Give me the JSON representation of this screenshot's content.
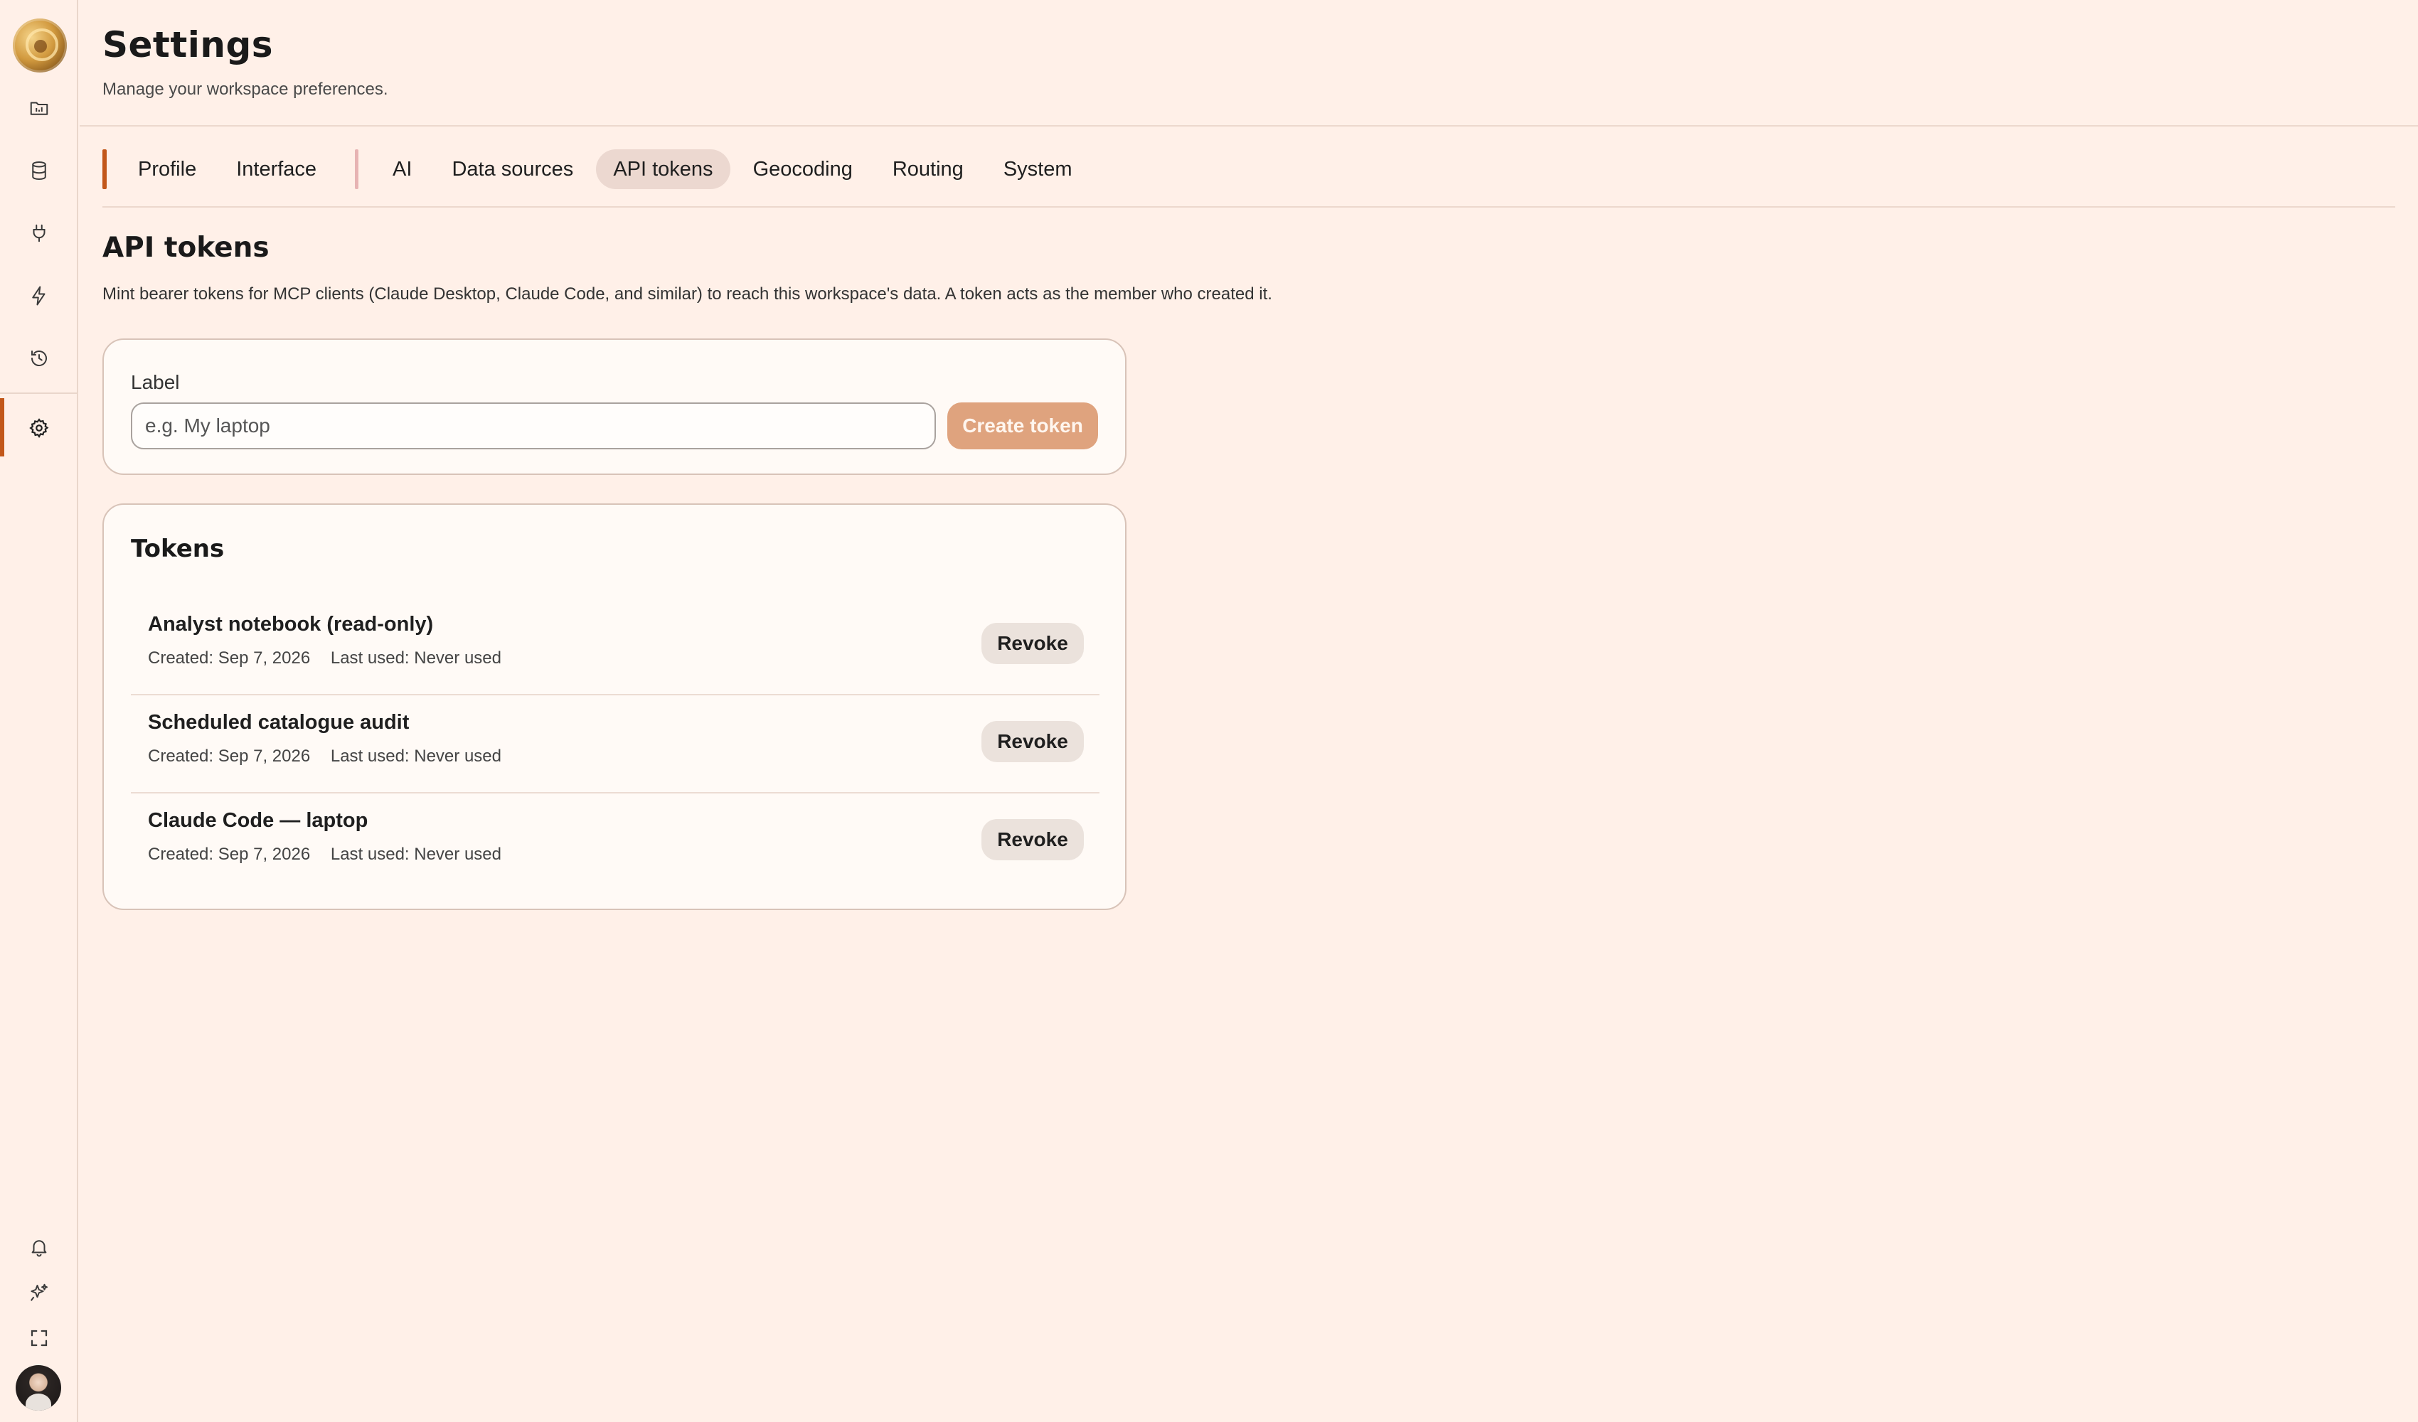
{
  "sidebar": {
    "active_item": "settings",
    "items": [
      {
        "id": "folder",
        "icon": "folder-icon"
      },
      {
        "id": "database",
        "icon": "database-icon"
      },
      {
        "id": "connections",
        "icon": "plug-icon"
      },
      {
        "id": "automations",
        "icon": "lightning-icon"
      },
      {
        "id": "history",
        "icon": "history-icon"
      },
      {
        "id": "settings",
        "icon": "gear-icon"
      }
    ],
    "bottom_items": [
      {
        "id": "notifications",
        "icon": "bell-icon"
      },
      {
        "id": "ai-assistant",
        "icon": "sparkle-icon"
      },
      {
        "id": "fullscreen",
        "icon": "expand-icon"
      }
    ]
  },
  "header": {
    "title": "Settings",
    "subtitle": "Manage your workspace preferences."
  },
  "tabs": [
    {
      "label": "Profile",
      "active": false
    },
    {
      "label": "Interface",
      "active": false
    },
    {
      "label": "AI",
      "active": false
    },
    {
      "label": "Data sources",
      "active": false
    },
    {
      "label": "API tokens",
      "active": true
    },
    {
      "label": "Geocoding",
      "active": false
    },
    {
      "label": "Routing",
      "active": false
    },
    {
      "label": "System",
      "active": false
    }
  ],
  "section": {
    "title": "API tokens",
    "description": "Mint bearer tokens for MCP clients (Claude Desktop, Claude Code, and similar) to reach this workspace's data. A token acts as the member who created it."
  },
  "create_form": {
    "label": "Label",
    "input_value": "",
    "input_placeholder": "e.g. My laptop",
    "button_label": "Create token"
  },
  "tokens_card": {
    "title": "Tokens",
    "revoke_label": "Revoke",
    "items": [
      {
        "name": "Analyst notebook (read-only)",
        "created": "Created: Sep 7, 2026",
        "last_used": "Last used: Never used"
      },
      {
        "name": "Scheduled catalogue audit",
        "created": "Created: Sep 7, 2026",
        "last_used": "Last used: Never used"
      },
      {
        "name": "Claude Code — laptop",
        "created": "Created: Sep 7, 2026",
        "last_used": "Last used: Never used"
      }
    ]
  },
  "colors": {
    "background": "#fff0e8",
    "accent": "#c2571a",
    "create_button": "#dfa37e",
    "active_tab": "#ecd8d0"
  }
}
